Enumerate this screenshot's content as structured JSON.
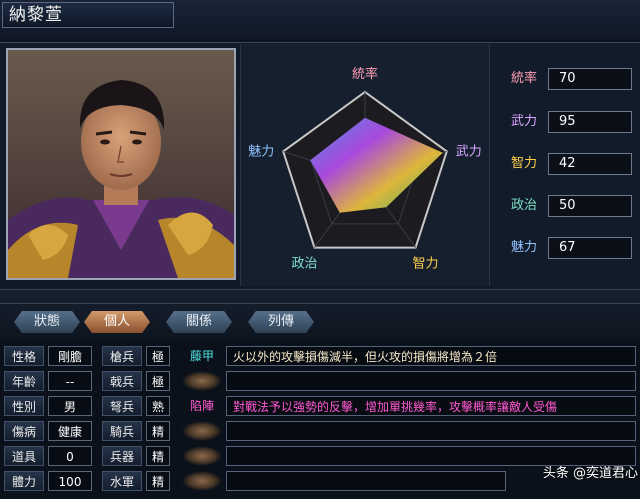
{
  "character": {
    "name": "納黎萱"
  },
  "radar": {
    "axes": [
      {
        "label": "統率",
        "value": 70,
        "color": "#ff9fb4"
      },
      {
        "label": "武力",
        "value": 95,
        "color": "#d9a6ff"
      },
      {
        "label": "智力",
        "value": 42,
        "color": "#ffd04a"
      },
      {
        "label": "政治",
        "value": 50,
        "color": "#7fe0c8"
      },
      {
        "label": "魅力",
        "value": 67,
        "color": "#8fc4ff"
      }
    ],
    "max": 100
  },
  "stats": [
    {
      "label": "統率",
      "value": "70",
      "color": "#ff9fb4"
    },
    {
      "label": "武力",
      "value": "95",
      "color": "#d9a6ff"
    },
    {
      "label": "智力",
      "value": "42",
      "color": "#ffd04a"
    },
    {
      "label": "政治",
      "value": "50",
      "color": "#7fe0c8"
    },
    {
      "label": "魅力",
      "value": "67",
      "color": "#8fc4ff"
    }
  ],
  "tabs": [
    {
      "label": "狀態",
      "active": false
    },
    {
      "label": "個人",
      "active": true
    },
    {
      "label": "關係",
      "active": false
    },
    {
      "label": "列傳",
      "active": false
    }
  ],
  "personal": [
    {
      "label": "性格",
      "value": "剛膽"
    },
    {
      "label": "年齡",
      "value": "--"
    },
    {
      "label": "性別",
      "value": "男"
    },
    {
      "label": "傷病",
      "value": "健康"
    },
    {
      "label": "道具",
      "value": "0"
    },
    {
      "label": "體力",
      "value": "100"
    }
  ],
  "aptitude": [
    {
      "label": "槍兵",
      "grade": "極"
    },
    {
      "label": "戟兵",
      "grade": "極"
    },
    {
      "label": "弩兵",
      "grade": "熟"
    },
    {
      "label": "騎兵",
      "grade": "精"
    },
    {
      "label": "兵器",
      "grade": "精"
    },
    {
      "label": "水軍",
      "grade": "精"
    }
  ],
  "skills": [
    {
      "name": "藤甲",
      "name_color": "#4fe0e0",
      "desc": "火以外的攻擊損傷減半，但火攻的損傷將增為２倍",
      "desc_color": "#f4e8c8"
    },
    {
      "name": "",
      "name_color": "",
      "desc": "",
      "desc_color": ""
    },
    {
      "name": "陷陣",
      "name_color": "#ff5ad0",
      "desc": "對戰法予以強勢的反擊，增加單挑幾率，攻擊概率讓敵人受傷",
      "desc_color": "#ff5ad0"
    },
    {
      "name": "",
      "name_color": "",
      "desc": "",
      "desc_color": ""
    },
    {
      "name": "",
      "name_color": "",
      "desc": "",
      "desc_color": ""
    },
    {
      "name": "",
      "name_color": "",
      "desc": "",
      "desc_color": ""
    }
  ],
  "watermark": "头条 @奕道君心"
}
